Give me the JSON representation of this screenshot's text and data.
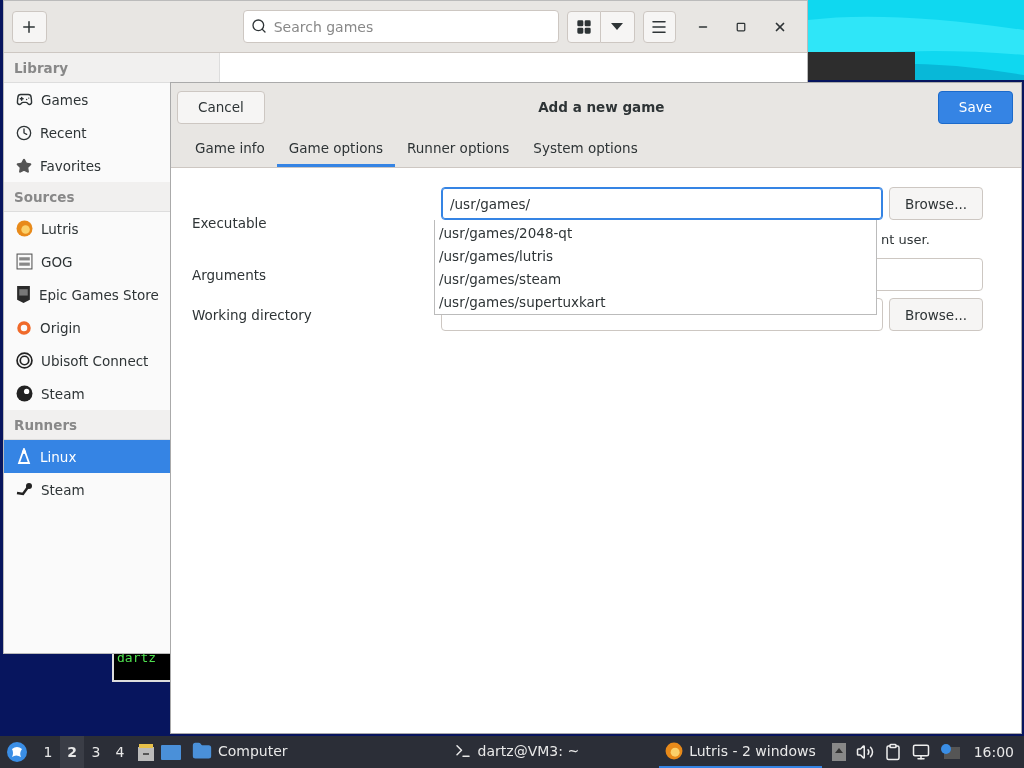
{
  "main_window": {
    "search": {
      "placeholder": "Search games"
    },
    "sidebar": [
      {
        "title": "Library",
        "items": [
          {
            "label": "Games",
            "selected": false
          },
          {
            "label": "Recent",
            "selected": false
          },
          {
            "label": "Favorites",
            "selected": false
          }
        ]
      },
      {
        "title": "Sources",
        "items": [
          {
            "label": "Lutris",
            "selected": false
          },
          {
            "label": "GOG",
            "selected": false
          },
          {
            "label": "Epic Games Store",
            "selected": false
          },
          {
            "label": "Origin",
            "selected": false
          },
          {
            "label": "Ubisoft Connect",
            "selected": false
          },
          {
            "label": "Steam",
            "selected": false
          }
        ]
      },
      {
        "title": "Runners",
        "items": [
          {
            "label": "Linux",
            "selected": true
          },
          {
            "label": "Steam",
            "selected": false
          }
        ]
      }
    ]
  },
  "terminal": {
    "text": "dartz"
  },
  "dialog": {
    "cancel": "Cancel",
    "title": "Add a new game",
    "save": "Save",
    "tabs": [
      {
        "label": "Game info",
        "selected": false
      },
      {
        "label": "Game options",
        "selected": true
      },
      {
        "label": "Runner options",
        "selected": false
      },
      {
        "label": "System options",
        "selected": false
      }
    ],
    "executable": {
      "label": "Executable",
      "value": "/usr/games/",
      "browse": "Browse...",
      "hint": "nt user."
    },
    "suggestions": [
      "/usr/games/2048-qt",
      "/usr/games/lutris",
      "/usr/games/steam",
      "/usr/games/supertuxkart"
    ],
    "arguments": {
      "label": "Arguments"
    },
    "working_directory": {
      "label": "Working directory",
      "browse": "Browse..."
    }
  },
  "taskbar": {
    "workspaces": [
      {
        "label": "1",
        "selected": false
      },
      {
        "label": "2",
        "selected": true
      },
      {
        "label": "3",
        "selected": false
      },
      {
        "label": "4",
        "selected": false
      }
    ],
    "tasks": [
      {
        "label": "Computer",
        "selected": false
      },
      {
        "label": "dartz@VM3: ~",
        "selected": false
      },
      {
        "label": "Lutris - 2 windows",
        "selected": true
      }
    ],
    "clock": "16:00"
  }
}
